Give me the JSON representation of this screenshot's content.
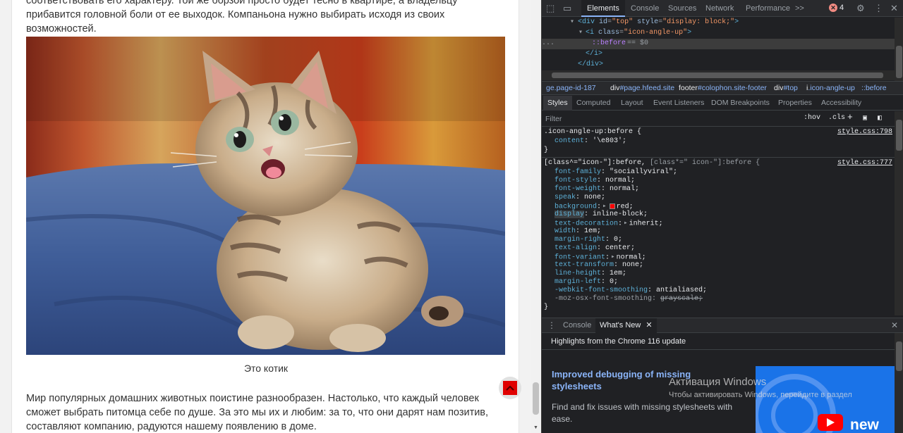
{
  "article": {
    "para_top": "соответствовать его характеру. Той же борзой просто будет тесно в квартире, а владельцу прибавится головной боли от ее выходок. Компаньона нужно выбирать исходя из своих возможностей.",
    "caption": "Это котик",
    "para_bottom": "Мир популярных домашних животных поистине разнообразен. Настолько, что каждый человек сможет выбрать питомца себе по душе. За это мы их и любим: за то, что они дарят нам позитив, составляют компанию, радуются нашему появлению в доме.",
    "scroll_top_icon": "chevron-up-icon",
    "accent_color": "#e00000"
  },
  "devtools": {
    "tabs": [
      "Elements",
      "Console",
      "Sources",
      "Network",
      "Performance"
    ],
    "more_tabs": ">>",
    "error_count": "4",
    "dom": {
      "line1_tag": "<div",
      "line1_attr1": "id",
      "line1_val1": "\"top\"",
      "line1_attr2": "style",
      "line1_val2": "\"display: block;\"",
      "line1_close": ">",
      "line2_tag": "<i",
      "line2_attr": "class",
      "line2_val": "\"icon-angle-up\"",
      "line2_close": ">",
      "line3_pseudo": "::before",
      "line3_eq": "== $0",
      "line4": "</i>",
      "line5": "</div>",
      "ellipsis": "..."
    },
    "breadcrumbs": [
      {
        "tag": "",
        "rest": "ge.page-id-187"
      },
      {
        "tag": "div",
        "rest": "#page.hfeed.site"
      },
      {
        "tag": "footer",
        "rest": "#colophon.site-footer"
      },
      {
        "tag": "div",
        "rest": "#top"
      },
      {
        "tag": "i",
        "rest": ".icon-angle-up"
      },
      {
        "tag": "",
        "rest": "::before"
      }
    ],
    "subtabs": [
      "Styles",
      "Computed",
      "Layout",
      "Event Listeners",
      "DOM Breakpoints",
      "Properties",
      "Accessibility"
    ],
    "filter": {
      "placeholder": "Filter",
      "hov": ":hov",
      "cls": ".cls"
    },
    "rule1": {
      "selector": ".icon-angle-up:before {",
      "source": "style.css:798",
      "prop": "content",
      "value": "'\\e803';",
      "close": "}"
    },
    "rule2": {
      "selector": "[class^=\"icon-\"]:before,",
      "selector_dim": "[class*=\" icon-\"]:before {",
      "source": "style.css:777",
      "props": [
        {
          "name": "font-family",
          "value": "\"sociallyviral\";"
        },
        {
          "name": "font-style",
          "value": "normal;"
        },
        {
          "name": "font-weight",
          "value": "normal;"
        },
        {
          "name": "speak",
          "value": "none;"
        },
        {
          "name": "background",
          "value": "red;"
        },
        {
          "name": "display",
          "value": "inline-block;"
        },
        {
          "name": "text-decoration",
          "value": "inherit;"
        },
        {
          "name": "width",
          "value": "1em;"
        },
        {
          "name": "margin-right",
          "value": "0;"
        },
        {
          "name": "text-align",
          "value": "center;"
        },
        {
          "name": "font-variant",
          "value": "normal;"
        },
        {
          "name": "text-transform",
          "value": "none;"
        },
        {
          "name": "line-height",
          "value": "1em;"
        },
        {
          "name": "margin-left",
          "value": "0;"
        },
        {
          "name": "-webkit-font-smoothing",
          "value": "antialiased;"
        },
        {
          "name": "-moz-osx-font-smoothing",
          "value": "grayscale;"
        }
      ],
      "close": "}"
    },
    "drawer": {
      "tabs": [
        "Console",
        "What's New"
      ],
      "header": "Highlights from the Chrome 116 update",
      "card_title": "Improved debugging of missing stylesheets",
      "card_text": "Find and fix issues with missing stylesheets with ease.",
      "watermark1": "Активация Windows",
      "watermark2": "Чтобы активировать Windows, перейдите в раздел",
      "thumb_text": "new"
    }
  }
}
